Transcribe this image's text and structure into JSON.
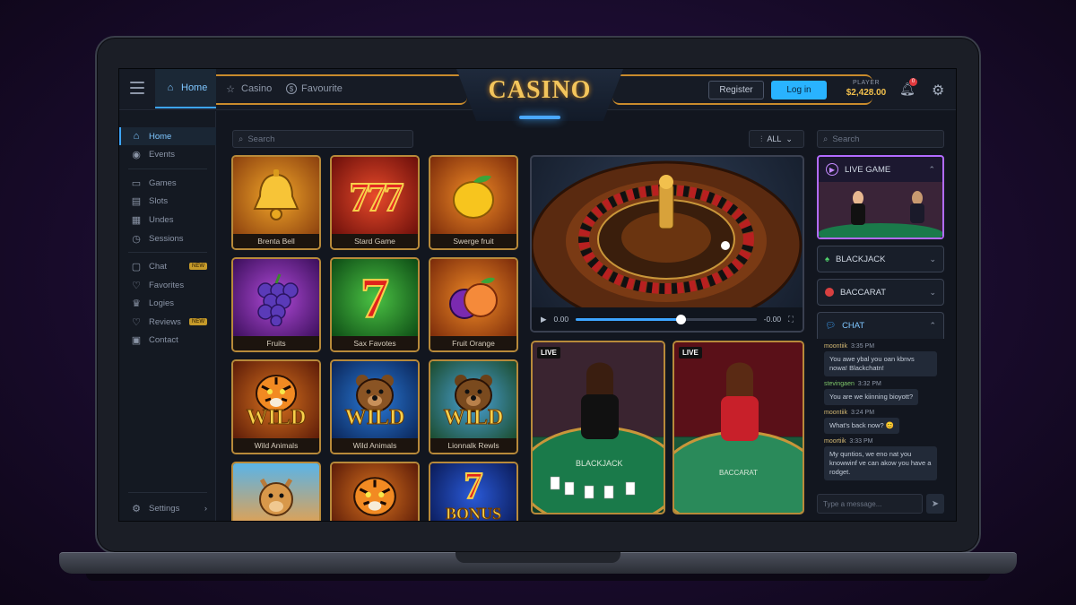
{
  "topbar": {
    "tabs": [
      {
        "label": "Home",
        "icon": "home-icon"
      },
      {
        "label": "Casino",
        "icon": "star-icon"
      },
      {
        "label": "Favourite",
        "icon": "dollar-circle-icon"
      }
    ],
    "logo": "CASINO",
    "register_label": "Register",
    "login_label": "Log in",
    "player_label": "PLAYER",
    "balance": "$2,428.00",
    "notification_count": "0"
  },
  "sidebar": {
    "items": [
      {
        "label": "Home",
        "icon": "home-icon"
      },
      {
        "label": "Events",
        "icon": "eye-icon"
      },
      {
        "label": "Games",
        "icon": "gamepad-icon"
      },
      {
        "label": "Slots",
        "icon": "slots-icon"
      },
      {
        "label": "Undes",
        "icon": "grid-icon"
      },
      {
        "label": "Sessions",
        "icon": "clock-icon"
      },
      {
        "label": "Chat",
        "icon": "chat-icon",
        "badge": "NEW"
      },
      {
        "label": "Favorites",
        "icon": "heart-icon"
      },
      {
        "label": "Logies",
        "icon": "trophy-icon"
      },
      {
        "label": "Reviews",
        "icon": "heart-icon",
        "badge": "NEW"
      },
      {
        "label": "Contact",
        "icon": "contact-icon"
      }
    ],
    "settings_label": "Settings"
  },
  "main": {
    "search_placeholder": "Search",
    "filter_label": "ALL",
    "games": [
      {
        "title": "Brenta Bell",
        "icon": "bell-icon"
      },
      {
        "title": "Stard Game",
        "icon": "777-icon"
      },
      {
        "title": "Swerge fruit",
        "icon": "lemon-icon"
      },
      {
        "title": "Fruits",
        "icon": "grapes-icon"
      },
      {
        "title": "Sax Favotes",
        "icon": "seven-icon"
      },
      {
        "title": "Fruit Orange",
        "icon": "plum-peach-icon"
      },
      {
        "title": "Wild Animals",
        "icon": "tiger-icon",
        "overlay": "WILD"
      },
      {
        "title": "Wild Animals",
        "icon": "bear-icon",
        "overlay": "WILD"
      },
      {
        "title": "Lionnalk Rewls",
        "icon": "bear-icon",
        "overlay": "WILD"
      },
      {
        "title": "",
        "icon": "camel-icon"
      },
      {
        "title": "",
        "icon": "tiger-icon"
      },
      {
        "title": "",
        "icon": "seven-bonus-icon",
        "overlay": "BONUS"
      }
    ],
    "video": {
      "time_current": "0.00",
      "time_remaining": "-0.00",
      "progress": 0.58
    },
    "live_tables": [
      {
        "tag": "LIVE",
        "table_text": "BLACKJACK"
      },
      {
        "tag": "LIVE",
        "table_text": "BACCARAT"
      }
    ]
  },
  "right": {
    "search_placeholder": "Search",
    "live_game_label": "LIVE GAME",
    "blackjack_label": "BLACKJACK",
    "baccarat_label": "BACCARAT",
    "chat_label": "CHAT",
    "messages": [
      {
        "user": "moontiik",
        "time": "3:35 PM",
        "text": "You awe ybal you oan kbnvs nowa! Blackchatn!"
      },
      {
        "user": "stevingaen",
        "time": "3:32 PM",
        "text": "You are we kiinning bioyott?"
      },
      {
        "user": "moontiik",
        "time": "3:24 PM",
        "text": "What's back now? 😊"
      },
      {
        "user": "moortiik",
        "time": "3:33 PM",
        "text": "My quntios, we eno nat you knowwinf ve can akow you have a rodget."
      }
    ],
    "message_placeholder": "Type a message..."
  },
  "colors": {
    "accent": "#3da5ff",
    "gold": "#f2c04d",
    "live_border": "#b26bff"
  }
}
